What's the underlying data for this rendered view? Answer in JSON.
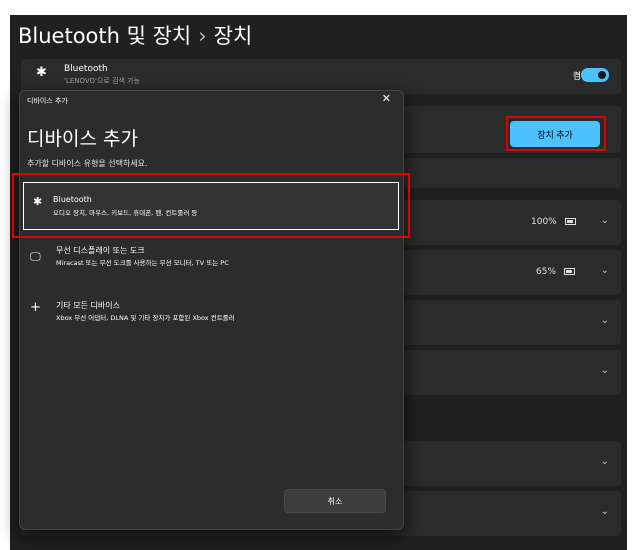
{
  "header": {
    "breadcrumb_parent": "Bluetooth 및 장치",
    "breadcrumb_sep": "›",
    "breadcrumb_current": "장치"
  },
  "bluetooth_card": {
    "icon": "bluetooth-icon",
    "title": "Bluetooth",
    "subtitle": "'LENOVO'으로 검색 가능",
    "toggle_label": "켬",
    "toggle_on": true,
    "accent_color": "#4cc2ff"
  },
  "add_device_button": {
    "label": "장치 추가"
  },
  "device_rows": [
    {
      "value": "100%",
      "icon": "battery-icon"
    },
    {
      "value": "65%",
      "icon": "battery-icon"
    },
    {
      "value": ""
    },
    {
      "value": ""
    },
    {
      "value": ""
    },
    {
      "value": ""
    }
  ],
  "dialog": {
    "caption": "디바이스 추가",
    "close_icon": "close-icon",
    "heading": "디바이스 추가",
    "subtitle": "추가할 디바이스 유형을 선택하세요.",
    "options": [
      {
        "icon": "bluetooth-icon",
        "title": "Bluetooth",
        "description": "오디오 장치, 마우스, 키보드, 휴대폰, 펜, 컨트롤러 등",
        "selected": true
      },
      {
        "icon": "monitor-icon",
        "title": "무선 디스플레이 또는 도크",
        "description": "Miracast 또는 무선 도크를 사용하는 무선 모니터, TV 또는 PC",
        "selected": false
      },
      {
        "icon": "plus-icon",
        "title": "기타 모든 디바이스",
        "description": "Xbox 무선 어댑터, DLNA 및 기타 장치가 포함된 Xbox 컨트롤러",
        "selected": false
      }
    ],
    "cancel_label": "취소"
  },
  "colors": {
    "highlight": "#e00000",
    "background": "#202020",
    "card": "#2b2b2b",
    "dialog": "#2c2c2c"
  }
}
